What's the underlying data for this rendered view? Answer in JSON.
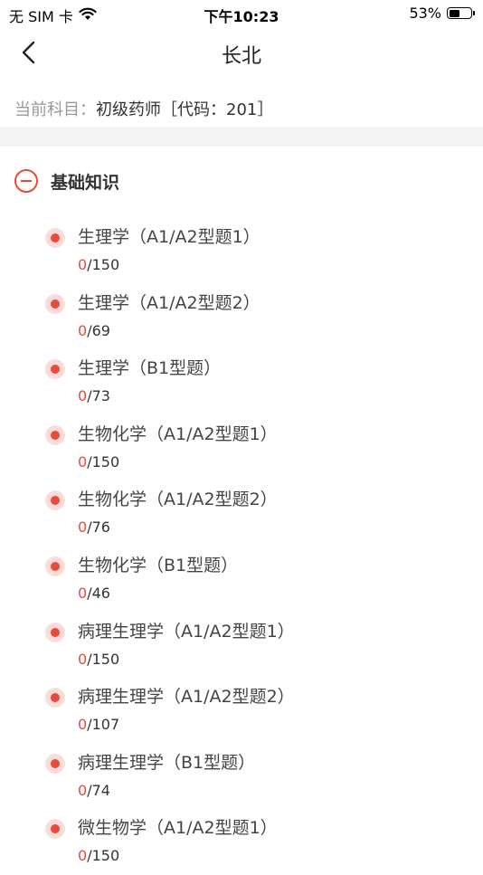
{
  "status_bar": {
    "carrier": "无 SIM 卡",
    "time": "下午10:23",
    "battery_text": "53%",
    "battery_level": 0.53,
    "icons": [
      "wifi-icon",
      "battery-icon"
    ]
  },
  "nav": {
    "title": "长北",
    "back_icon": "chevron-left-icon"
  },
  "subject": {
    "label": "当前科目：",
    "value": "初级药师［代码：201］"
  },
  "section": {
    "title": "基础知识",
    "icon": "collapse-minus-icon"
  },
  "items": [
    {
      "title": "生理学（A1/A2型题1）",
      "done": "0",
      "total": "/150"
    },
    {
      "title": "生理学（A1/A2型题2）",
      "done": "0",
      "total": "/69"
    },
    {
      "title": "生理学（B1型题）",
      "done": "0",
      "total": "/73"
    },
    {
      "title": "生物化学（A1/A2型题1）",
      "done": "0",
      "total": "/150"
    },
    {
      "title": "生物化学（A1/A2型题2）",
      "done": "0",
      "total": "/76"
    },
    {
      "title": "生物化学（B1型题）",
      "done": "0",
      "total": "/46"
    },
    {
      "title": "病理生理学（A1/A2型题1）",
      "done": "0",
      "total": "/150"
    },
    {
      "title": "病理生理学（A1/A2型题2）",
      "done": "0",
      "total": "/107"
    },
    {
      "title": "病理生理学（B1型题）",
      "done": "0",
      "total": "/74"
    },
    {
      "title": "微生物学（A1/A2型题1）",
      "done": "0",
      "total": "/150"
    }
  ],
  "colors": {
    "accent": "#e84a3c",
    "accent_light": "#fbdcd9",
    "divider": "#f4f4f4",
    "label_gray": "#999999"
  }
}
